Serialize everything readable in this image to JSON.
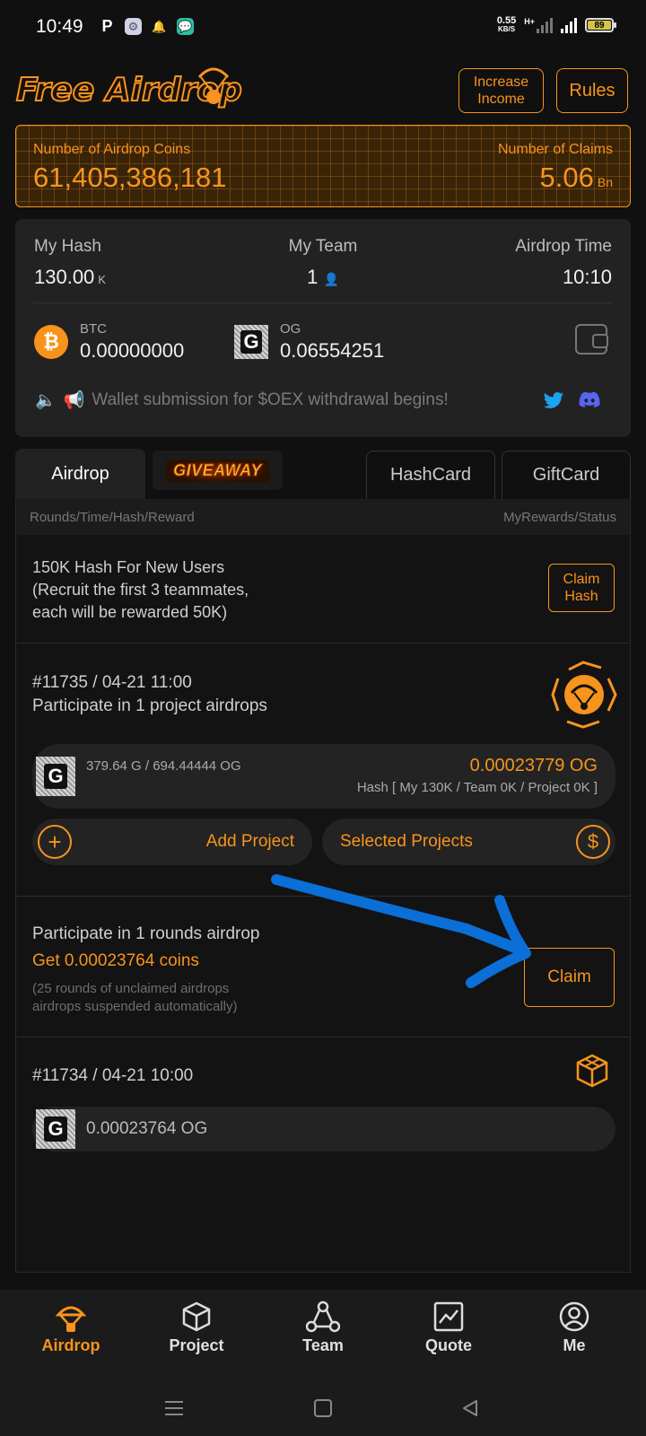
{
  "status_bar": {
    "time": "10:49",
    "speed_value": "0.55",
    "speed_unit": "KB/S",
    "network": "H+",
    "battery": "89"
  },
  "header": {
    "logo_text": "Free Airdrop",
    "increase_income_label": "Increase Income",
    "rules_label": "Rules"
  },
  "banner": {
    "coins_label": "Number of Airdrop Coins",
    "coins_value": "61,405,386,181",
    "claims_label": "Number of Claims",
    "claims_value": "5.06",
    "claims_unit": "Bn"
  },
  "stats": {
    "my_hash_label": "My Hash",
    "my_hash_value": "130.00",
    "my_hash_unit": "K",
    "my_team_label": "My Team",
    "my_team_value": "1",
    "airdrop_time_label": "Airdrop Time",
    "airdrop_time_value": "10:10",
    "btc_name": "BTC",
    "btc_value": "0.00000000",
    "og_name": "OG",
    "og_value": "0.06554251",
    "announcement": "Wallet submission for $OEX withdrawal begins!"
  },
  "tabs": {
    "airdrop": "Airdrop",
    "giveaway": "GIVEAWAY",
    "hashcard": "HashCard",
    "giftcard": "GiftCard"
  },
  "list_header": {
    "left": "Rounds/Time/Hash/Reward",
    "right": "MyRewards/Status"
  },
  "promo": {
    "line1": "150K Hash For New Users",
    "line2": "(Recruit the first 3 teammates,",
    "line3": "each will be rewarded 50K)",
    "button": "Claim Hash"
  },
  "round1": {
    "title": "#11735 / 04-21 11:00",
    "subtitle": "Participate in 1 project airdrops",
    "project_amount": "379.64 G / 694.44444 OG",
    "reward": "0.00023779 OG",
    "hash_detail": "Hash [ My 130K / Team 0K / Project 0K ]",
    "add_project": "Add Project",
    "selected_projects": "Selected Projects"
  },
  "claim_section": {
    "line1": "Participate in 1 rounds airdrop",
    "line2": "Get 0.00023764 coins",
    "note1": "(25 rounds of unclaimed airdrops",
    "note2": "airdrops suspended automatically)",
    "button": "Claim"
  },
  "round2": {
    "title": "#11734 / 04-21 10:00",
    "reward": "0.00023764 OG"
  },
  "bottom_nav": {
    "airdrop": "Airdrop",
    "project": "Project",
    "team": "Team",
    "quote": "Quote",
    "me": "Me"
  },
  "colors": {
    "accent": "#f7941d",
    "annotation_arrow": "#0a6fd6",
    "background": "#101010"
  }
}
